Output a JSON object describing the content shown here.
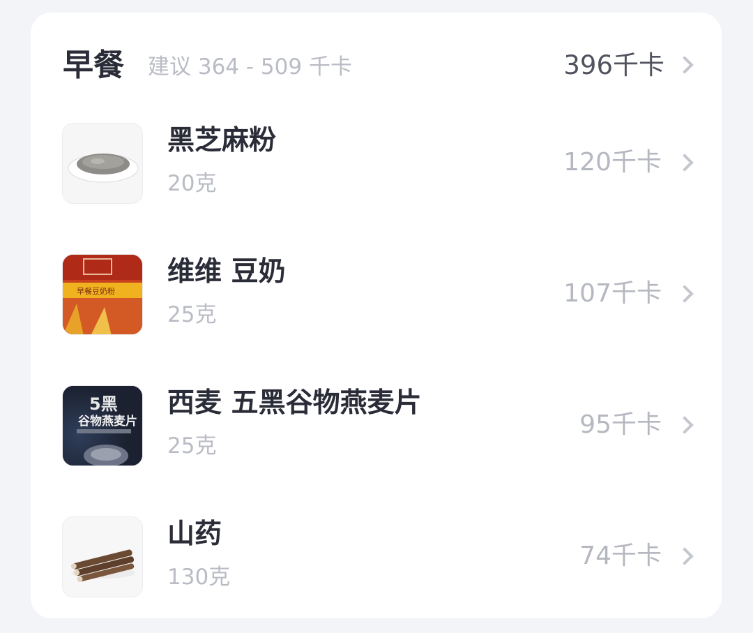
{
  "meal": {
    "title": "早餐",
    "suggestion": "建议 364 - 509 千卡",
    "total": "396千卡"
  },
  "items": [
    {
      "name": "黑芝麻粉",
      "amount": "20克",
      "kcal": "120千卡",
      "icon": "sesame-powder-photo"
    },
    {
      "name": "维维 豆奶",
      "amount": "25克",
      "kcal": "107千卡",
      "icon": "soy-milk-package-photo"
    },
    {
      "name": "西麦 五黑谷物燕麦片",
      "amount": "25克",
      "kcal": "95千卡",
      "icon": "cereal-package-photo"
    },
    {
      "name": "山药",
      "amount": "130克",
      "kcal": "74千卡",
      "icon": "yam-photo"
    }
  ],
  "thumb_text": {
    "soy_pkg": "早餐豆奶粉",
    "cereal_big": "5黑",
    "cereal_sub": "谷物燕麦片"
  },
  "colors": {
    "background": "#f3f4f8",
    "card": "#ffffff",
    "primary_text": "#2a2c38",
    "secondary_text": "#b9bcc4"
  }
}
